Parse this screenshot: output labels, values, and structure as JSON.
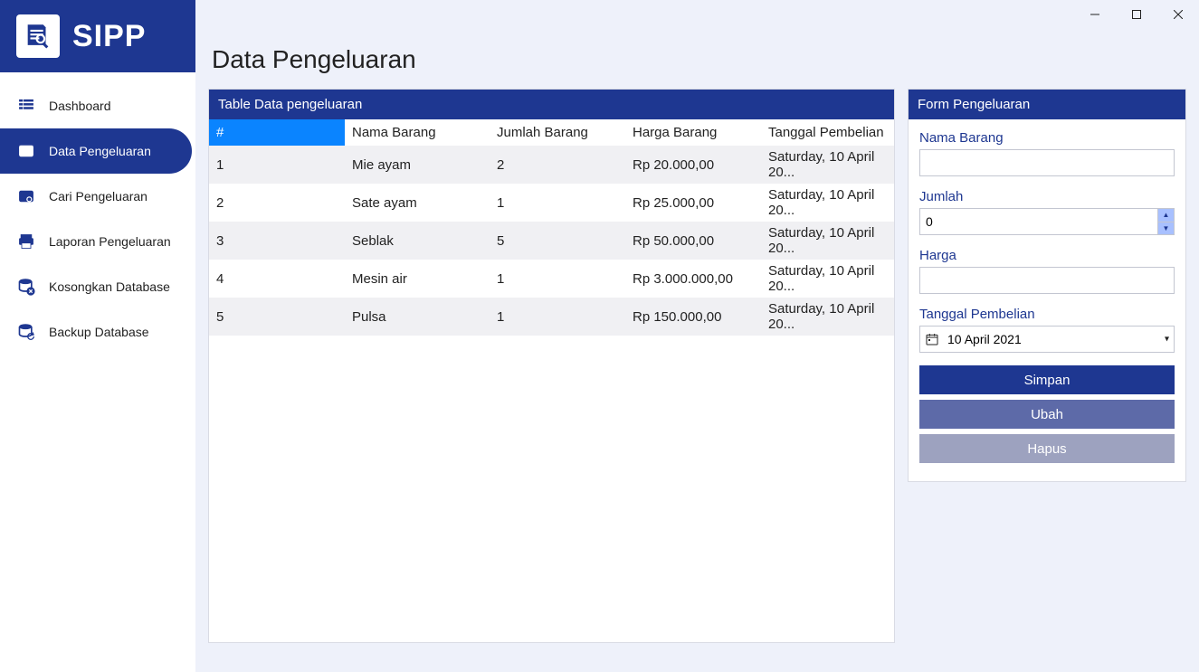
{
  "brand": {
    "name": "SIPP"
  },
  "sidebar": {
    "items": [
      {
        "label": "Dashboard"
      },
      {
        "label": "Data Pengeluaran"
      },
      {
        "label": "Cari Pengeluaran"
      },
      {
        "label": "Laporan Pengeluaran"
      },
      {
        "label": "Kosongkan Database"
      },
      {
        "label": "Backup Database"
      }
    ],
    "active_index": 1
  },
  "page": {
    "title": "Data Pengeluaran"
  },
  "table": {
    "title": "Table Data pengeluaran",
    "columns": [
      "#",
      "Nama Barang",
      "Jumlah Barang",
      "Harga Barang",
      "Tanggal Pembelian"
    ],
    "selected_col": 0,
    "rows": [
      {
        "idx": "1",
        "name": "Mie ayam",
        "qty": "2",
        "price": "Rp  20.000,00",
        "date": "Saturday, 10 April 20..."
      },
      {
        "idx": "2",
        "name": "Sate ayam",
        "qty": "1",
        "price": "Rp  25.000,00",
        "date": "Saturday, 10 April 20..."
      },
      {
        "idx": "3",
        "name": "Seblak",
        "qty": "5",
        "price": "Rp  50.000,00",
        "date": "Saturday, 10 April 20..."
      },
      {
        "idx": "4",
        "name": "Mesin air",
        "qty": "1",
        "price": "Rp  3.000.000,00",
        "date": "Saturday, 10 April 20..."
      },
      {
        "idx": "5",
        "name": "Pulsa",
        "qty": "1",
        "price": "Rp  150.000,00",
        "date": "Saturday, 10 April 20..."
      }
    ]
  },
  "form": {
    "title": "Form Pengeluaran",
    "labels": {
      "name": "Nama Barang",
      "qty": "Jumlah",
      "price": "Harga",
      "date": "Tanggal Pembelian"
    },
    "values": {
      "name": "",
      "qty": "0",
      "price": "",
      "date": "10 April 2021"
    },
    "buttons": {
      "save": "Simpan",
      "edit": "Ubah",
      "delete": "Hapus"
    }
  }
}
